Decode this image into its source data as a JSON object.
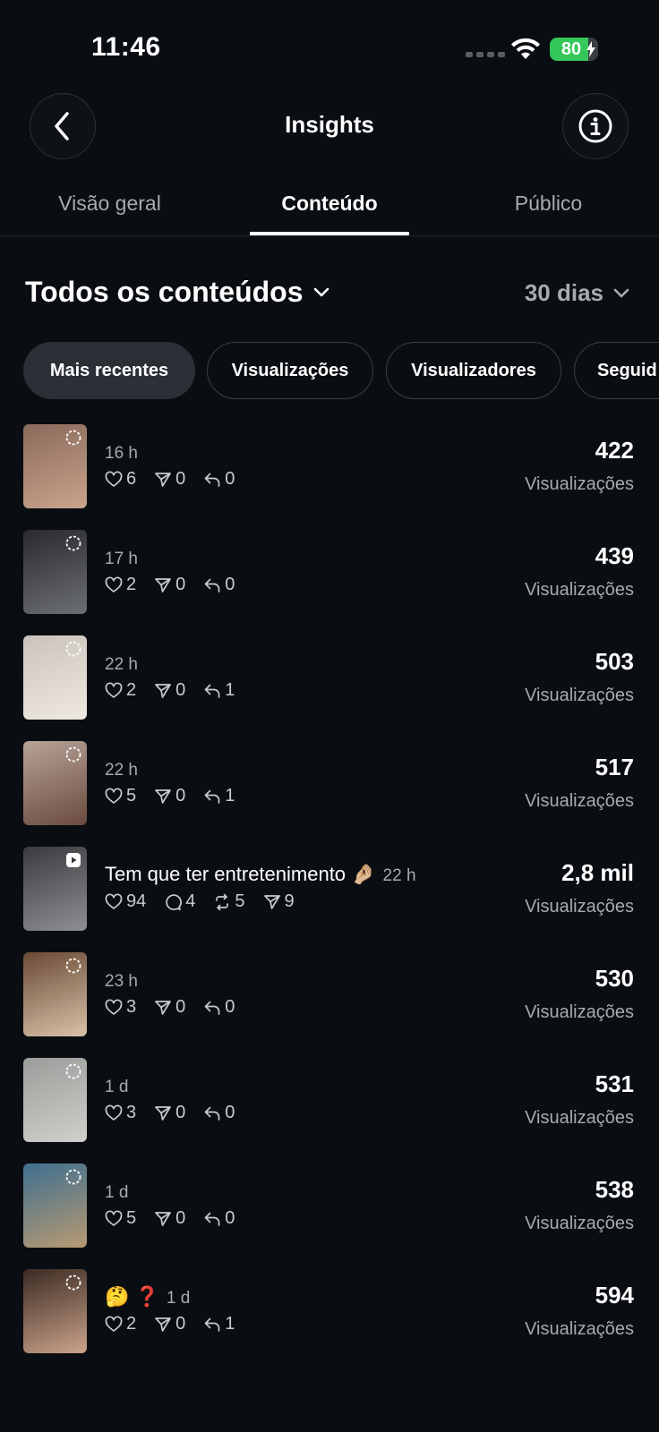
{
  "status_bar": {
    "time": "11:46",
    "battery": "80",
    "battery_level": 0.8,
    "colors": {
      "battery": "#35c759"
    }
  },
  "header": {
    "title": "Insights",
    "back_icon": "chevron-left-icon",
    "info_icon": "info-icon"
  },
  "tabs": [
    {
      "label": "Visão geral",
      "active": false
    },
    {
      "label": "Conteúdo",
      "active": true
    },
    {
      "label": "Público",
      "active": false
    }
  ],
  "filter": {
    "content_label": "Todos os conteúdos",
    "period_label": "30 dias"
  },
  "chips": [
    {
      "label": "Mais recentes",
      "active": true
    },
    {
      "label": "Visualizações",
      "active": false
    },
    {
      "label": "Visualizadores",
      "active": false
    },
    {
      "label": "Seguid",
      "active": false
    }
  ],
  "items": [
    {
      "caption": "",
      "time": "16 h",
      "type": "story",
      "stats": [
        {
          "icon": "heart-icon",
          "value": "6"
        },
        {
          "icon": "send-icon",
          "value": "0"
        },
        {
          "icon": "reply-icon",
          "value": "0"
        }
      ],
      "views": "422",
      "views_label": "Visualizações",
      "thumb_colors": [
        "#8a6a5a",
        "#c9a48c"
      ]
    },
    {
      "caption": "",
      "time": "17 h",
      "type": "story",
      "stats": [
        {
          "icon": "heart-icon",
          "value": "2"
        },
        {
          "icon": "send-icon",
          "value": "0"
        },
        {
          "icon": "reply-icon",
          "value": "0"
        }
      ],
      "views": "439",
      "views_label": "Visualizações",
      "thumb_colors": [
        "#2a2a2e",
        "#6c6f73"
      ]
    },
    {
      "caption": "",
      "time": "22 h",
      "type": "story",
      "stats": [
        {
          "icon": "heart-icon",
          "value": "2"
        },
        {
          "icon": "send-icon",
          "value": "0"
        },
        {
          "icon": "reply-icon",
          "value": "1"
        }
      ],
      "views": "503",
      "views_label": "Visualizações",
      "thumb_colors": [
        "#c9c3bb",
        "#efe9e2"
      ]
    },
    {
      "caption": "",
      "time": "22 h",
      "type": "story",
      "stats": [
        {
          "icon": "heart-icon",
          "value": "5"
        },
        {
          "icon": "send-icon",
          "value": "0"
        },
        {
          "icon": "reply-icon",
          "value": "1"
        }
      ],
      "views": "517",
      "views_label": "Visualizações",
      "thumb_colors": [
        "#b7a398",
        "#6b4a3e"
      ]
    },
    {
      "caption": "Tem que ter entretenimento 🤌🏼",
      "time": "22 h",
      "type": "reel",
      "stats": [
        {
          "icon": "heart-icon",
          "value": "94"
        },
        {
          "icon": "comment-icon",
          "value": "4"
        },
        {
          "icon": "repost-icon",
          "value": "5"
        },
        {
          "icon": "send-icon",
          "value": "9"
        }
      ],
      "views": "2,8 mil",
      "views_label": "Visualizações",
      "thumb_colors": [
        "#3a3b3e",
        "#8d8f92"
      ]
    },
    {
      "caption": "",
      "time": "23 h",
      "type": "story",
      "stats": [
        {
          "icon": "heart-icon",
          "value": "3"
        },
        {
          "icon": "send-icon",
          "value": "0"
        },
        {
          "icon": "reply-icon",
          "value": "0"
        }
      ],
      "views": "530",
      "views_label": "Visualizações",
      "thumb_colors": [
        "#6a4a35",
        "#d8c2a8"
      ]
    },
    {
      "caption": "",
      "time": "1 d",
      "type": "story",
      "stats": [
        {
          "icon": "heart-icon",
          "value": "3"
        },
        {
          "icon": "send-icon",
          "value": "0"
        },
        {
          "icon": "reply-icon",
          "value": "0"
        }
      ],
      "views": "531",
      "views_label": "Visualizações",
      "thumb_colors": [
        "#9b9d9a",
        "#cfd0cc"
      ]
    },
    {
      "caption": "",
      "time": "1 d",
      "type": "story",
      "stats": [
        {
          "icon": "heart-icon",
          "value": "5"
        },
        {
          "icon": "send-icon",
          "value": "0"
        },
        {
          "icon": "reply-icon",
          "value": "0"
        }
      ],
      "views": "538",
      "views_label": "Visualizações",
      "thumb_colors": [
        "#3f6f8f",
        "#b79a72"
      ]
    },
    {
      "caption": "🤔 ❓",
      "time": "1 d",
      "type": "story",
      "stats": [
        {
          "icon": "heart-icon",
          "value": "2"
        },
        {
          "icon": "send-icon",
          "value": "0"
        },
        {
          "icon": "reply-icon",
          "value": "1"
        }
      ],
      "views": "594",
      "views_label": "Visualizações",
      "thumb_colors": [
        "#3b2a22",
        "#caa38a"
      ]
    }
  ]
}
